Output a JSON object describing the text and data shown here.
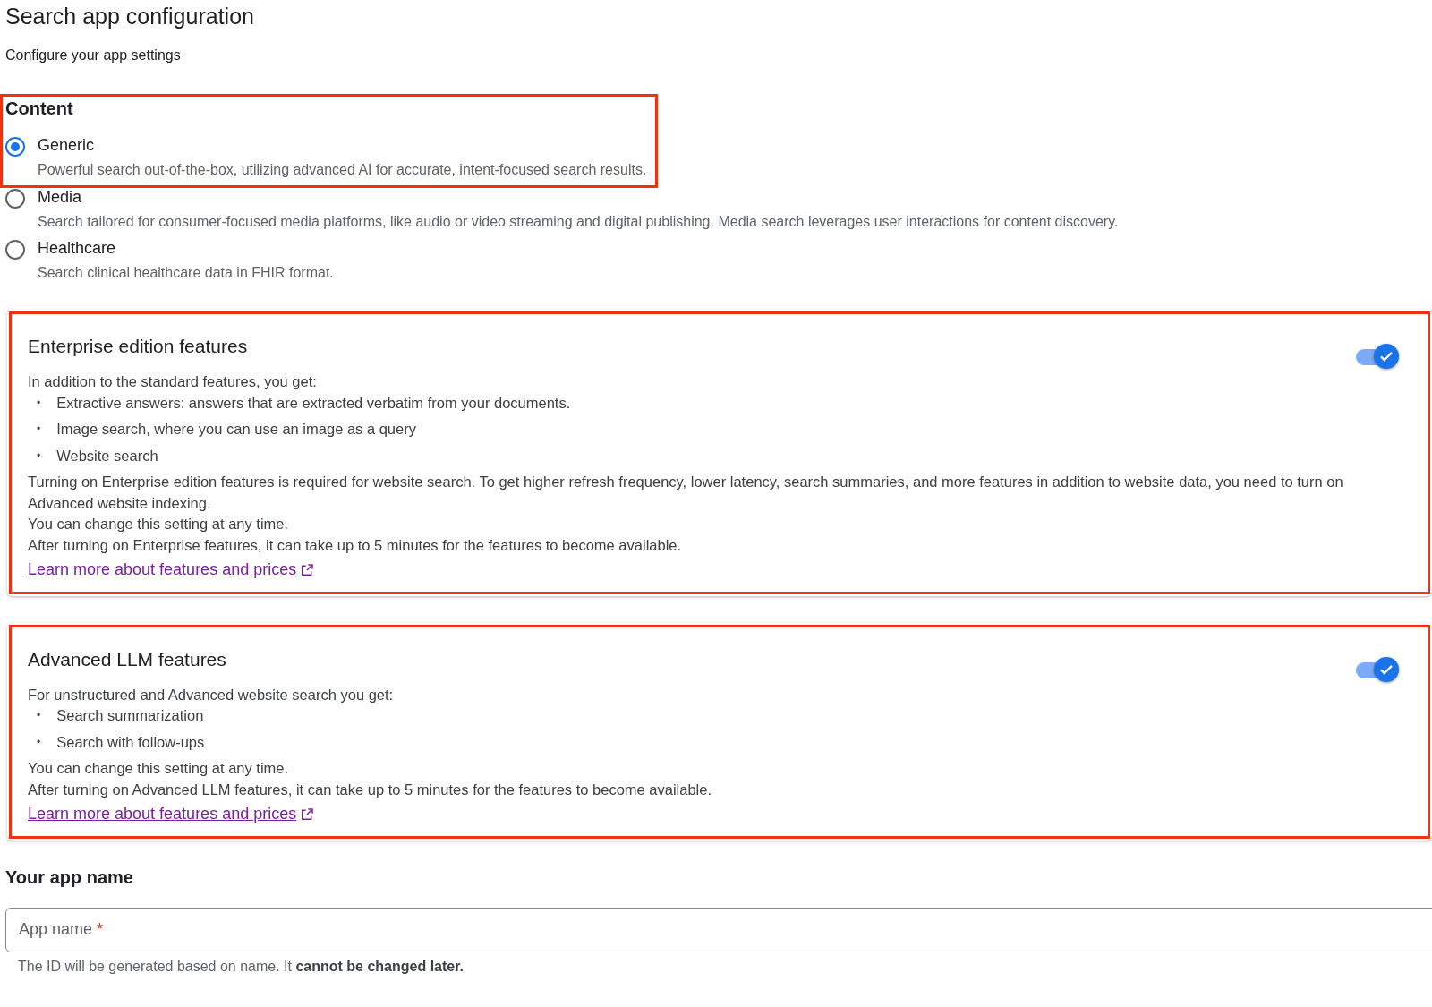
{
  "page": {
    "title": "Search app configuration",
    "subtitle": "Configure your app settings"
  },
  "content": {
    "heading": "Content",
    "options": [
      {
        "label": "Generic",
        "description": "Powerful search out-of-the-box, utilizing advanced AI for accurate, intent-focused search results.",
        "selected": true,
        "highlighted": true
      },
      {
        "label": "Media",
        "description": "Search tailored for consumer-focused media platforms, like audio or video streaming and digital publishing. Media search leverages user interactions for content discovery.",
        "selected": false,
        "highlighted": false
      },
      {
        "label": "Healthcare",
        "description": "Search clinical healthcare data in FHIR format.",
        "selected": false,
        "highlighted": false
      }
    ]
  },
  "features": [
    {
      "title": "Enterprise edition features",
      "on": true,
      "bullet_marker": "•",
      "highlighted": true,
      "intro": "In addition to the standard features, you get:",
      "bullets": [
        "Extractive answers: answers that are extracted verbatim from your documents.",
        "Image search, where you can use an image as a query",
        "Website search"
      ],
      "notes": [
        "Turning on Enterprise edition features is required for website search. To get higher refresh frequency, lower latency, search summaries, and more features in addition to website data, you need to turn on Advanced website indexing.",
        "You can change this setting at any time.",
        "After turning on Enterprise features, it can take up to 5 minutes for the features to become available."
      ],
      "link": "Learn more about features and prices"
    },
    {
      "title": "Advanced LLM features",
      "on": true,
      "bullet_marker": "•",
      "highlighted": true,
      "intro": "For unstructured and Advanced website search you get:",
      "bullets": [
        "Search summarization",
        "Search with follow-ups"
      ],
      "notes": [
        "You can change this setting at any time.",
        "After turning on Advanced LLM features, it can take up to 5 minutes for the features to become available."
      ],
      "link": "Learn more about features and prices"
    }
  ],
  "app_name": {
    "heading": "Your app name",
    "placeholder": "App name",
    "required_mark": "*",
    "hint": "The ID will be generated based on name. It **cannot be changed later.**"
  }
}
